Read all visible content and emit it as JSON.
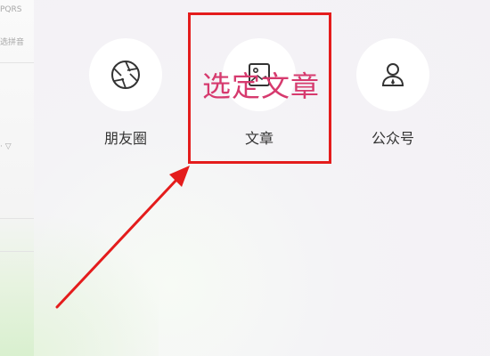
{
  "left_panel": {
    "snippet_top": "PQRS",
    "snippet_pinyin": "选拼音",
    "snippet_dropdown": "· ▽"
  },
  "share_options": [
    {
      "label": "朋友圈",
      "icon": "aperture-icon"
    },
    {
      "label": "文章",
      "icon": "image-icon"
    },
    {
      "label": "公众号",
      "icon": "person-icon"
    }
  ],
  "annotation": {
    "text": "选定文章",
    "color": "#d63a6e"
  },
  "colors": {
    "highlight_box": "#e41c1c",
    "arrow": "#e41c1c"
  }
}
